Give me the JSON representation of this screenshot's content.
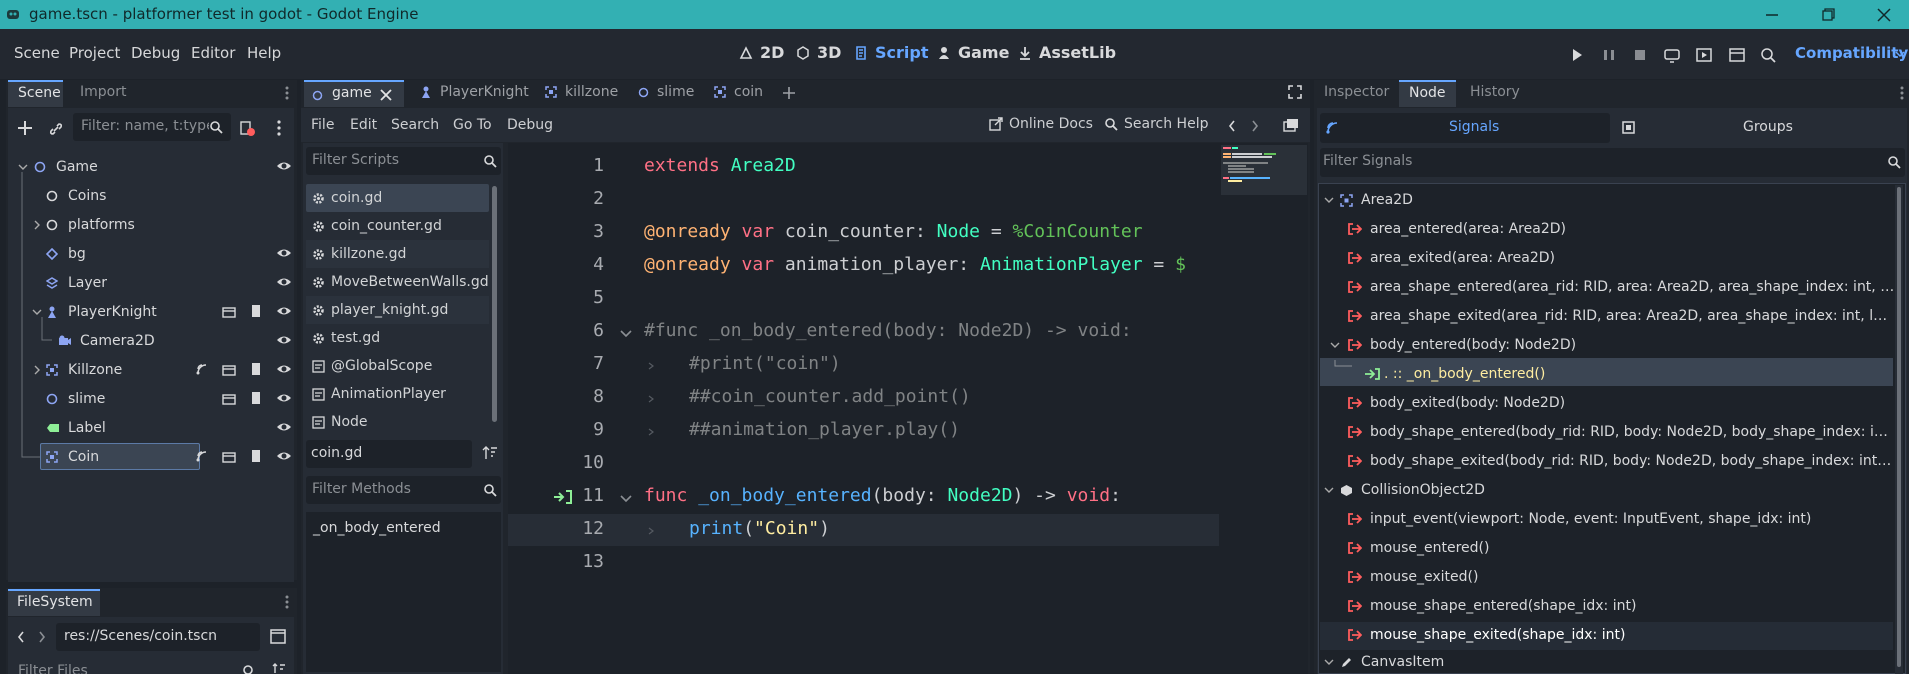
{
  "window": {
    "title": "game.tscn - platformer test in godot - Godot Engine"
  },
  "menu": [
    "Scene",
    "Project",
    "Debug",
    "Editor",
    "Help"
  ],
  "workspaces": [
    "2D",
    "3D",
    "Script",
    "Game",
    "AssetLib"
  ],
  "renderer": "Compatibility",
  "scene_dock": {
    "tabs": [
      "Scene",
      "Import"
    ],
    "filter_placeholder": "Filter: name, t:type",
    "nodes": [
      {
        "label": "Game",
        "icon": "node2d-icon"
      },
      {
        "label": "Coins",
        "icon": "node2d-icon"
      },
      {
        "label": "platforms",
        "icon": "node2d-icon"
      },
      {
        "label": "bg",
        "icon": "parallax-icon"
      },
      {
        "label": "Layer",
        "icon": "tilemap-layer-icon"
      },
      {
        "label": "PlayerKnight",
        "icon": "character-body-icon"
      },
      {
        "label": "Camera2D",
        "icon": "camera-icon"
      },
      {
        "label": "Killzone",
        "icon": "area2d-icon"
      },
      {
        "label": "slime",
        "icon": "node2d-icon"
      },
      {
        "label": "Label",
        "icon": "label-icon"
      },
      {
        "label": "Coin",
        "icon": "area2d-icon"
      }
    ]
  },
  "filesystem": {
    "tab": "FileSystem",
    "path": "res://Scenes/coin.tscn",
    "filter_placeholder": "Filter Files"
  },
  "editor_tabs": [
    "game",
    "PlayerKnight",
    "killzone",
    "slime",
    "coin"
  ],
  "script_menu": [
    "File",
    "Edit",
    "Search",
    "Go To",
    "Debug"
  ],
  "script_toolbar": {
    "online_docs": "Online Docs",
    "search_help": "Search Help"
  },
  "scripts": {
    "filter_placeholder": "Filter Scripts",
    "items": [
      "coin.gd",
      "coin_counter.gd",
      "killzone.gd",
      "MoveBetweenWalls.gd",
      "player_knight.gd",
      "test.gd",
      "@GlobalScope",
      "AnimationPlayer",
      "Node"
    ],
    "current": "coin.gd",
    "methods_placeholder": "Filter Methods",
    "methods": [
      "_on_body_entered"
    ]
  },
  "code_lines": [
    "1",
    "2",
    "3",
    "4",
    "5",
    "6",
    "7",
    "8",
    "9",
    "10",
    "11",
    "12",
    "13"
  ],
  "code": {
    "l1": {
      "kw": "extends",
      "ty": "Area2D"
    },
    "l3": {
      "ann": "@onready",
      "kw": "var",
      "name": "coin_counter:",
      "ty": "Node",
      "eq": "=",
      "node": "%CoinCounter"
    },
    "l4": {
      "ann": "@onready",
      "kw": "var",
      "name": "animation_player:",
      "ty": "AnimationPlayer",
      "eq": "=",
      "node": "$"
    },
    "l6": "#func _on_body_entered(body: Node2D) -> void:",
    "l7": "#print(\"coin\")",
    "l8": "##coin_counter.add_point()",
    "l9": "##animation_player.play()",
    "l11": {
      "kw": "func",
      "fn": "_on_body_entered",
      "open": "(body:",
      "ty": "Node2D",
      "rest": ") ->",
      "ret": "void",
      "colon": ":"
    },
    "l12": {
      "fn": "print",
      "open": "(",
      "str": "\"Coin\"",
      "close": ")"
    }
  },
  "inspector": {
    "tabs": [
      "Inspector",
      "Node",
      "History"
    ],
    "subtabs": [
      "Signals",
      "Groups"
    ],
    "filter_placeholder": "Filter Signals"
  },
  "signals": [
    {
      "label": "Area2D",
      "kind": "class"
    },
    {
      "label": "area_entered(area: Area2D)",
      "kind": "signal"
    },
    {
      "label": "area_exited(area: Area2D)",
      "kind": "signal"
    },
    {
      "label": "area_shape_entered(area_rid: RID, area: Area2D, area_shape_index: int, local_...",
      "kind": "signal"
    },
    {
      "label": "area_shape_exited(area_rid: RID, area: Area2D, area_shape_index: int, local_s...",
      "kind": "signal"
    },
    {
      "label": "body_entered(body: Node2D)",
      "kind": "signal"
    },
    {
      "label": ". :: _on_body_entered()",
      "kind": "connection"
    },
    {
      "label": "body_exited(body: Node2D)",
      "kind": "signal"
    },
    {
      "label": "body_shape_entered(body_rid: RID, body: Node2D, body_shape_index: int, loc...",
      "kind": "signal"
    },
    {
      "label": "body_shape_exited(body_rid: RID, body: Node2D, body_shape_index: int, local...",
      "kind": "signal"
    },
    {
      "label": "CollisionObject2D",
      "kind": "class"
    },
    {
      "label": "input_event(viewport: Node, event: InputEvent, shape_idx: int)",
      "kind": "signal"
    },
    {
      "label": "mouse_entered()",
      "kind": "signal"
    },
    {
      "label": "mouse_exited()",
      "kind": "signal"
    },
    {
      "label": "mouse_shape_entered(shape_idx: int)",
      "kind": "signal"
    },
    {
      "label": "mouse_shape_exited(shape_idx: int)",
      "kind": "signal"
    },
    {
      "label": "CanvasItem",
      "kind": "class"
    }
  ],
  "colors": {
    "accent": "#66a6ff",
    "titlebar": "#33b0b3",
    "signal": "#ff5d5d",
    "connection": "#8eef97"
  }
}
